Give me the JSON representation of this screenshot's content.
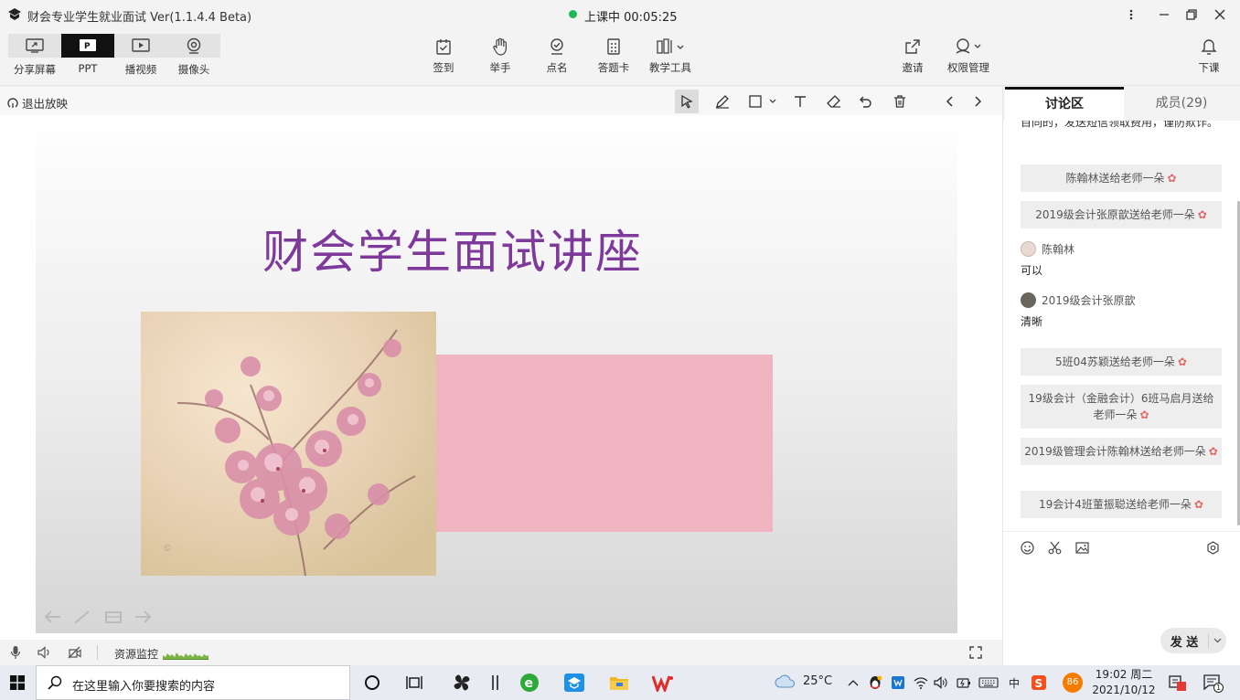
{
  "window": {
    "title": "财会专业学生就业面试 Ver(1.1.4.4 Beta)",
    "class_status": "上课中 00:05:25"
  },
  "modes": [
    {
      "label": "分享屏幕",
      "icon": "share-screen-icon"
    },
    {
      "label": "PPT",
      "icon": "ppt-icon",
      "active": true
    },
    {
      "label": "播视频",
      "icon": "play-video-icon"
    },
    {
      "label": "摄像头",
      "icon": "camera-icon"
    }
  ],
  "tools": [
    {
      "label": "签到",
      "icon": "sign-in-icon"
    },
    {
      "label": "举手",
      "icon": "raise-hand-icon"
    },
    {
      "label": "点名",
      "icon": "roll-call-icon"
    },
    {
      "label": "答题卡",
      "icon": "answer-card-icon"
    },
    {
      "label": "教学工具",
      "icon": "teaching-tools-icon"
    }
  ],
  "right_tools": [
    {
      "label": "邀请",
      "icon": "invite-icon"
    },
    {
      "label": "权限管理",
      "icon": "permission-icon"
    },
    {
      "label": "下课",
      "icon": "end-class-icon"
    }
  ],
  "subbar": {
    "exit_label": "退出放映"
  },
  "slide": {
    "title": "财会学生面试讲座"
  },
  "bottom": {
    "monitor_label": "资源监控"
  },
  "panel": {
    "tabs": [
      {
        "label": "讨论区",
        "active": true
      },
      {
        "label": "成员(29)"
      }
    ],
    "top_text": "目同的，发送短信领取费用，谨防欺诈。",
    "messages": [
      {
        "type": "gift",
        "text": "陈翰林送给老师一朵"
      },
      {
        "type": "gift",
        "text": "2019级会计张原歆送给老师一朵"
      },
      {
        "type": "chat",
        "user": "陈翰林",
        "text": "可以"
      },
      {
        "type": "chat",
        "user": "2019级会计张原歆",
        "text": "清晰"
      },
      {
        "type": "gift",
        "text": "5班04苏颖送给老师一朵"
      },
      {
        "type": "gift",
        "text": "19级会计（金融会计）6班马启月送给老师一朵"
      },
      {
        "type": "gift",
        "text": "2019级管理会计陈翰林送给老师一朵"
      },
      {
        "type": "gift",
        "text": "19会计4班董振聪送给老师一朵"
      }
    ],
    "send_label": "发 送"
  },
  "taskbar": {
    "search_placeholder": "在这里输入你要搜索的内容",
    "weather": "25°C",
    "ime": "中",
    "badge": "86",
    "time": "19:02 周二",
    "date": "2021/10/12",
    "notify_count": "1"
  },
  "colors": {
    "title_purple": "#7d3a9b",
    "pink_block": "#efb4bf",
    "live_green": "#1db954"
  }
}
